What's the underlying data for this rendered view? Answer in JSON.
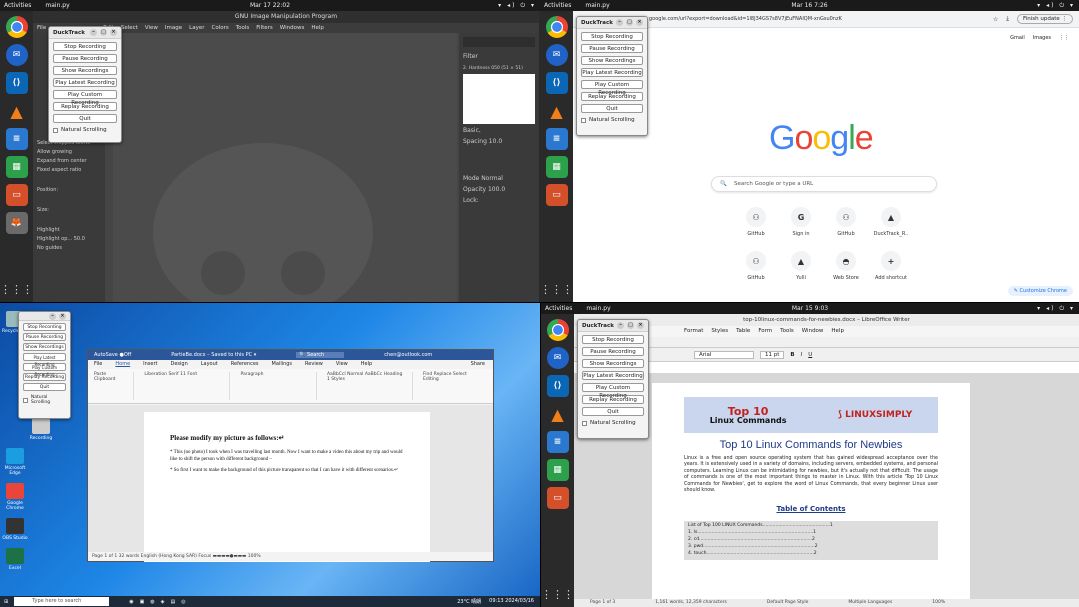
{
  "ubuntu_topbar": {
    "activities": "Activities",
    "app": "main.py",
    "tray": "▾ ◂) ⏻ ▾"
  },
  "q1": {
    "clock": "Mar 17  22:02",
    "gimp": {
      "title": "GNU Image Manipulation Program",
      "menu": [
        "File",
        "Edit",
        "Select",
        "View",
        "Image",
        "Layer",
        "Colors",
        "Tools",
        "Filters",
        "Windows",
        "Help"
      ],
      "tool_options": [
        "Select cropped alerts",
        "Allow growing",
        "Expand from center",
        "Fixed  aspect ratio",
        "Position:",
        "Size:",
        "Highlight",
        "Highlight op...  50.0",
        "No guides"
      ],
      "brush_panel": [
        "Filter",
        "2. Hardness 050 (51 × 51)",
        "Basic,",
        "Spacing  10.0",
        "Mode  Normal",
        "Opacity  100.0",
        "Lock:"
      ]
    }
  },
  "q2": {
    "clock": "Mar 16  7:26",
    "url": "google.com/url?export=download&id=1l8J34GS7s8V7jEuFNAIQM-xnGsu0nzK",
    "finish_update": "Finish update ⋮",
    "top_links": [
      "Gmail",
      "Images"
    ],
    "logo": [
      "G",
      "o",
      "o",
      "g",
      "l",
      "e"
    ],
    "logo_colors": [
      "#4285f4",
      "#ea4335",
      "#fbbc05",
      "#4285f4",
      "#34a853",
      "#ea4335"
    ],
    "search_placeholder": "Search Google or type a URL",
    "shortcuts_row1": [
      {
        "label": "GitHub",
        "icon": "⚇"
      },
      {
        "label": "Sign in",
        "icon": "G"
      },
      {
        "label": "GitHub",
        "icon": "⚇"
      },
      {
        "label": "DuckTrack_R..",
        "icon": "▲"
      }
    ],
    "shortcuts_row2": [
      {
        "label": "GitHub",
        "icon": "⚇"
      },
      {
        "label": "Yulli",
        "icon": "▲"
      },
      {
        "label": "Web Store",
        "icon": "◓"
      },
      {
        "label": "Add shortcut",
        "icon": "+"
      }
    ],
    "customize": "✎ Customize Chrome"
  },
  "q3": {
    "desktop_icons": [
      "Recycle Bin",
      "Zoom",
      "Recording",
      "Microsoft Edge",
      "Google Chrome",
      "OBS Studio",
      "Excel",
      "Vector"
    ],
    "word": {
      "titlebar": [
        "AutoSave ●Off",
        "PartieBe.docx – Saved to this PC ▾",
        "🔍 Search",
        "chen@outlook.com"
      ],
      "tabs": [
        "File",
        "Home",
        "Insert",
        "Design",
        "Layout",
        "References",
        "Mailings",
        "Review",
        "View",
        "Help",
        "Share"
      ],
      "ribbon": [
        "Paste  Clipboard",
        "Liberation Serif  11  Font",
        "Paragraph",
        "AaBbCcI Normal  AaBbCc Heading 1  Styles",
        "Find  Replace  Select  Editing"
      ],
      "heading": "Please modify my picture as follows:↵",
      "para1": "* This (no photo) I took when I was travelling last month. Now I want to make a video this about my trip and would like to shift the person with different background –",
      "para2": "* So first I want to make the background of this picture transparent so that I can have it with different scenarios.↵",
      "status": "Page 1 of 1    32 words    English (Hong Kong SAR)          Focus       ▬▬▬▬●▬▬▬  100%"
    },
    "taskbar": {
      "search": "Type here to search",
      "weather": "23°C 晴朗",
      "time": "09:13  2024/03/16"
    }
  },
  "q4": {
    "clock": "Mar 15  9:03",
    "title": "top-10linux-commands-for-newbies.docx – LibreOffice Writer",
    "menu": [
      "Format",
      "Styles",
      "Table",
      "Form",
      "Tools",
      "Window",
      "Help"
    ],
    "font": "Arial",
    "size": "11 pt",
    "banner_top": "Top 10",
    "banner_sub": "Linux Commands",
    "banner_brand": "⟆ LINUXSIMPLY",
    "heading": "Top 10 Linux Commands for Newbies",
    "para": "Linux is a free and open source operating system that has gained widespread acceptance over the years. It is extensively used in a variety of domains, including servers, embedded systems, and personal computers. Learning Linux can be intimidating for newbies, but it's actually not that difficult. The usage of commands is one of the most important things to master in Linux. With this article 'Top 10 Linux Commands for Newbies', get to explore the word of Linux Commands, that every beginner Linux user should know.",
    "toc_heading": "Table of Contents",
    "toc": [
      "List of Top 100 LINUX Commands...............................................1",
      "1. ls.................................................................................1",
      "2. cd...............................................................................2",
      "3. pwd..............................................................................2",
      "4. touch...........................................................................2"
    ],
    "status": [
      "Page 1 of 3",
      "1,161 words, 12,359 characters",
      "Default Page Style",
      "Multiple Languages",
      "100%"
    ]
  },
  "ducktrack": {
    "title": "DuckTrack",
    "buttons": [
      "Stop Recording",
      "Pause Recording",
      "Show Recordings",
      "Play Latest Recording",
      "Play Custom Recording",
      "Replay Recording",
      "Quit"
    ],
    "checkbox": "Natural Scrolling"
  }
}
